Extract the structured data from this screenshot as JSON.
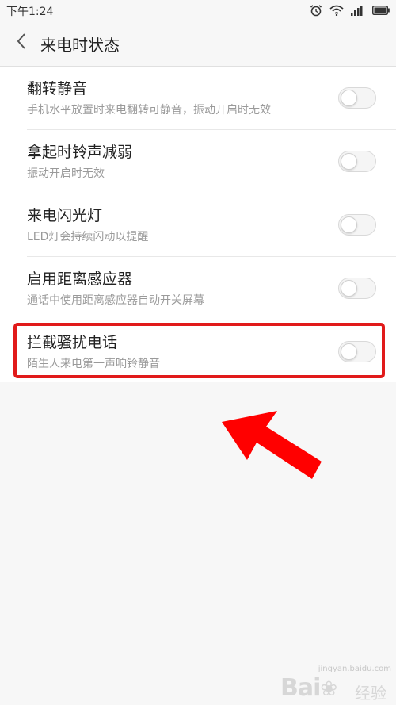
{
  "status_bar": {
    "time": "下午1:24",
    "icons": [
      "alarm-icon",
      "wifi-icon",
      "signal-icon",
      "battery-icon"
    ]
  },
  "header": {
    "title": "来电时状态",
    "back_icon": "chevron-left-icon"
  },
  "settings": [
    {
      "title": "翻转静音",
      "subtitle": "手机水平放置时来电翻转可静音，振动开启时无效",
      "enabled": false
    },
    {
      "title": "拿起时铃声减弱",
      "subtitle": "振动开启时无效",
      "enabled": false
    },
    {
      "title": "来电闪光灯",
      "subtitle": "LED灯会持续闪动以提醒",
      "enabled": false
    },
    {
      "title": "启用距离感应器",
      "subtitle": "通话中使用距离感应器自动开关屏幕",
      "enabled": false
    },
    {
      "title": "拦截骚扰电话",
      "subtitle": "陌生人来电第一声响铃静音",
      "enabled": false
    }
  ],
  "annotation": {
    "highlight_color": "#e11a1a",
    "arrow_color": "#ff0000"
  },
  "watermark": {
    "url": "jingyan.baidu.com",
    "logo": "Bai",
    "logo_suffix": "经验"
  }
}
